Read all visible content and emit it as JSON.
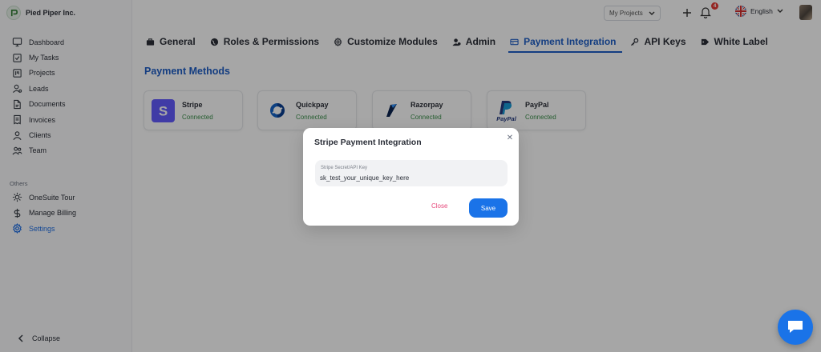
{
  "brand": {
    "name": "Pied Piper Inc."
  },
  "sidebar": {
    "items": [
      {
        "label": "Dashboard",
        "icon": "dashboard-icon"
      },
      {
        "label": "My Tasks",
        "icon": "tasks-icon"
      },
      {
        "label": "Projects",
        "icon": "projects-icon"
      },
      {
        "label": "Leads",
        "icon": "leads-icon"
      },
      {
        "label": "Documents",
        "icon": "documents-icon"
      },
      {
        "label": "Invoices",
        "icon": "invoices-icon"
      },
      {
        "label": "Clients",
        "icon": "clients-icon"
      },
      {
        "label": "Team",
        "icon": "team-icon"
      }
    ],
    "others_label": "Others",
    "others": [
      {
        "label": "OneSuite Tour",
        "icon": "sun-icon"
      },
      {
        "label": "Manage Billing",
        "icon": "dollar-icon"
      },
      {
        "label": "Settings",
        "icon": "gear-icon",
        "active": true
      }
    ],
    "collapse_label": "Collapse"
  },
  "topbar": {
    "project_select": "My Projects",
    "notification_count": "4",
    "language": "English"
  },
  "tabs": [
    {
      "label": "General",
      "icon": "briefcase-icon"
    },
    {
      "label": "Roles & Permissions",
      "icon": "globe-icon"
    },
    {
      "label": "Customize Modules",
      "icon": "gear-icon"
    },
    {
      "label": "Admin",
      "icon": "admin-icon"
    },
    {
      "label": "Payment Integration",
      "icon": "payment-icon",
      "active": true
    },
    {
      "label": "API Keys",
      "icon": "key-icon"
    },
    {
      "label": "White Label",
      "icon": "tag-icon"
    }
  ],
  "main": {
    "section_title": "Payment Methods",
    "methods": [
      {
        "name": "Stripe",
        "status": "Connected",
        "logo": "stripe-logo"
      },
      {
        "name": "Quickpay",
        "status": "Connected",
        "logo": "quickpay-logo"
      },
      {
        "name": "Razorpay",
        "status": "Connected",
        "logo": "razorpay-logo"
      },
      {
        "name": "PayPal",
        "status": "Connected",
        "logo": "paypal-logo"
      }
    ]
  },
  "modal": {
    "title": "Stripe Payment Integration",
    "field_label": "Stripe Secret/API Key",
    "field_value": "sk_test_your_unique_key_here",
    "close_label": "Close",
    "save_label": "Save"
  },
  "colors": {
    "accent": "#1f5fc6",
    "primary_button": "#1a73e8",
    "connected": "#3a8f4a",
    "close_text": "#e6497b",
    "badge": "#e53935"
  }
}
